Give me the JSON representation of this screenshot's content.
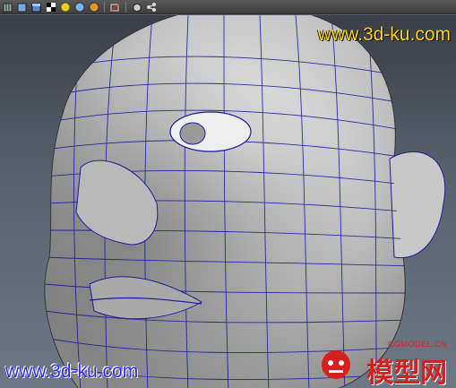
{
  "toolbar": {
    "icons": [
      "grid-cube-icon",
      "cube-icon",
      "shaded-cube-icon",
      "checker-icon",
      "light-yellow-icon",
      "light-blue-icon",
      "light-gold-icon",
      "camera-icon",
      "cube-select-icon",
      "share-icon"
    ]
  },
  "watermarks": {
    "top_text": "www.3d-ku.com",
    "bottom_text": "www.3d-ku.com",
    "logo_site": "CGMODEL.CN",
    "logo_label": "模型网"
  },
  "colors": {
    "watermark_top": "#ffd800",
    "watermark_bottom": "#2b2bff",
    "wireframe": "#1a1aa0",
    "logo_red": "#e02020"
  }
}
